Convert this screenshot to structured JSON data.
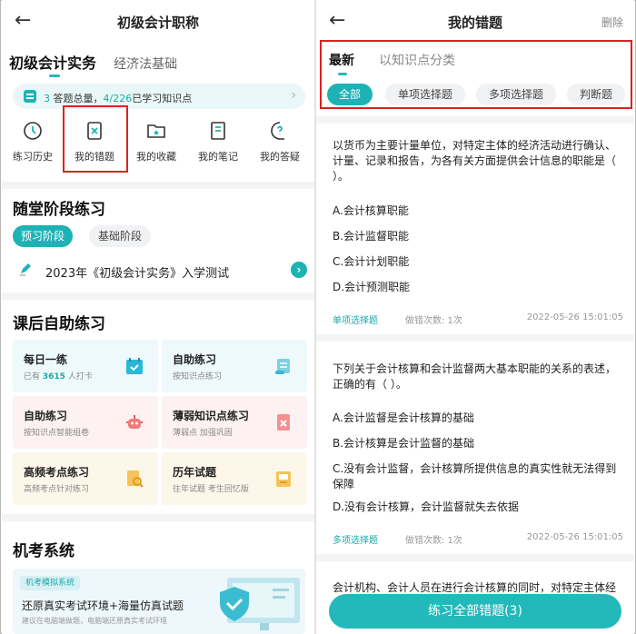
{
  "left": {
    "header": {
      "title": "初级会计职称"
    },
    "subject_tabs": [
      "初级会计实务",
      "经济法基础"
    ],
    "info_bar": {
      "count": "3",
      "label1": "答题总量，",
      "progress": "4/226",
      "label2": "已学习知识点"
    },
    "quick_links": [
      {
        "label": "练习历史",
        "icon": "history-icon"
      },
      {
        "label": "我的错题",
        "icon": "wrong-questions-icon"
      },
      {
        "label": "我的收藏",
        "icon": "favorites-folder-icon"
      },
      {
        "label": "我的笔记",
        "icon": "notes-icon"
      },
      {
        "label": "我的答疑",
        "icon": "qa-icon"
      }
    ],
    "class_practice": {
      "title": "随堂阶段练习",
      "stages": [
        "预习阶段",
        "基础阶段"
      ],
      "test": "2023年《初级会计实务》入学测试"
    },
    "after_class": {
      "title": "课后自助练习",
      "cards": [
        {
          "title": "每日一练",
          "sub_prefix": "已有",
          "sub_count": "3615",
          "sub_suffix": "人打卡",
          "icon": "calendar-check-icon"
        },
        {
          "title": "自助练习",
          "sub": "按知识点练习",
          "icon": "scroll-icon"
        },
        {
          "title": "自助练习",
          "sub": "按知识点智能组卷",
          "icon": "robot-icon"
        },
        {
          "title": "薄弱知识点练习",
          "sub": "薄弱点  加强巩固",
          "icon": "weak-point-icon"
        },
        {
          "title": "高频考点练习",
          "sub": "高频考点针对练习",
          "icon": "document-search-icon"
        },
        {
          "title": "历年试题",
          "sub": "往年试题  考生回忆版",
          "icon": "folder-paper-icon"
        }
      ]
    },
    "exam_system": {
      "title": "机考系统",
      "tag": "机考模拟系统",
      "main": "还原真实考试环境+海量仿真试题",
      "sub": "建议在电脑端做题，电脑端还原真实考试环境"
    }
  },
  "right": {
    "header": {
      "title": "我的错题",
      "action": "删除"
    },
    "tabs": [
      "最新",
      "以知识点分类"
    ],
    "filters": [
      "全部",
      "单项选择题",
      "多项选择题",
      "判断题"
    ],
    "questions": [
      {
        "text": "以货币为主要计量单位，对特定主体的经济活动进行确认、计量、记录和报告，为各有关方面提供会计信息的职能是（    ）。",
        "options": [
          "A.会计核算职能",
          "B.会计监督职能",
          "C.会计计划职能",
          "D.会计预测职能"
        ],
        "type": "单项选择题",
        "wrong_count": "做错次数: 1次",
        "time": "2022-05-26 15:01:05"
      },
      {
        "text": "下列关于会计核算和会计监督两大基本职能的关系的表述，正确的有（  ）。",
        "options": [
          "A.会计监督是会计核算的基础",
          "B.会计核算是会计监督的基础",
          "C.没有会计监督，会计核算所提供信息的真实性就无法得到保障",
          "D.没有会计核算，会计监督就失去依据"
        ],
        "type": "多项选择题",
        "wrong_count": "做错次数: 1次",
        "time": "2022-05-26 15:01:05"
      }
    ],
    "next_peek": "会计机构、会计人员在进行会计核算的同时，对特定主体经",
    "bottom_button": "练习全部错题(3)"
  },
  "colors": {
    "accent": "#1db3b5",
    "highlight_box": "#e02020"
  }
}
